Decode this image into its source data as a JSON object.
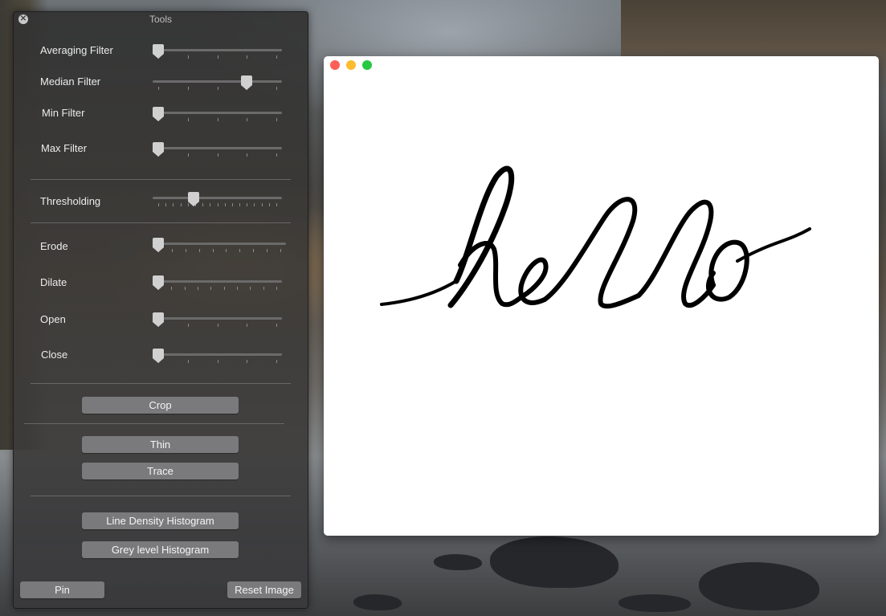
{
  "tools_panel": {
    "title": "Tools",
    "sliders": [
      {
        "label": "Averaging Filter",
        "value_fraction": 0.0,
        "ticks": 5
      },
      {
        "label": "Median Filter",
        "value_fraction": 0.75,
        "ticks": 5
      },
      {
        "label": "Min Filter",
        "value_fraction": 0.0,
        "ticks": 5
      },
      {
        "label": "Max Filter",
        "value_fraction": 0.0,
        "ticks": 5
      },
      {
        "label": "Thresholding",
        "value_fraction": 0.3,
        "ticks": 17
      },
      {
        "label": "Erode",
        "value_fraction": 0.0,
        "ticks": 10
      },
      {
        "label": "Dilate",
        "value_fraction": 0.0,
        "ticks": 10
      },
      {
        "label": "Open",
        "value_fraction": 0.0,
        "ticks": 5
      },
      {
        "label": "Close",
        "value_fraction": 0.0,
        "ticks": 5
      }
    ],
    "buttons": {
      "crop": "Crop",
      "thin": "Thin",
      "trace": "Trace",
      "line_density": "Line Density Histogram",
      "grey_level": "Grey level Histogram",
      "pin": "Pin",
      "reset": "Reset Image"
    }
  },
  "image_window": {
    "traffic_lights": {
      "close": "#fc5f57",
      "minimize": "#fdbc2e",
      "zoom": "#28c840"
    },
    "image_text": "hello"
  },
  "colors": {
    "panel_button": "#7a7a7c",
    "slider_knob": "#d0d0d0"
  }
}
